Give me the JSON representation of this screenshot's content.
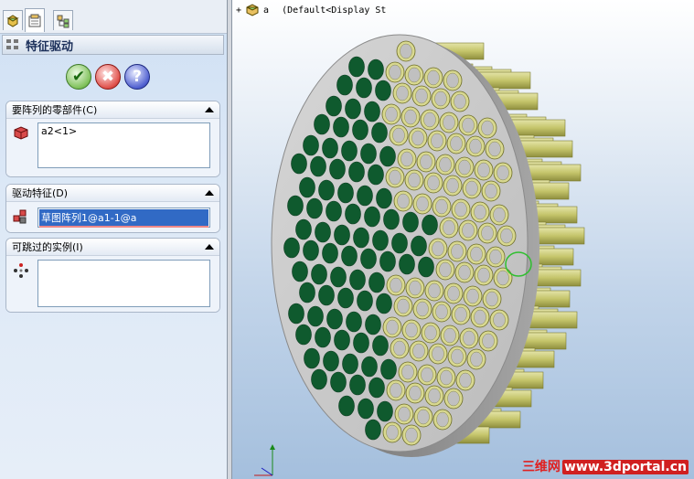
{
  "panel": {
    "title": "特征驱动",
    "buttons": {
      "ok": "✔",
      "cancel": "✖",
      "help": "?"
    },
    "sections": [
      {
        "label": "要阵列的零部件(C)",
        "value": "a2<1>"
      },
      {
        "label": "驱动特征(D)",
        "value": "草图阵列1@a1-1@a"
      },
      {
        "label": "可跳过的实例(I)",
        "value": ""
      }
    ]
  },
  "viewport": {
    "tree_label": "a",
    "tree_config": "(Default<Display St",
    "watermark_cn": "三维网",
    "watermark_url": "www.3dportal.cn",
    "colors": {
      "hole": "#0f5a2e",
      "plate": "#c8c8c8",
      "tube": "#c8c86a"
    }
  }
}
